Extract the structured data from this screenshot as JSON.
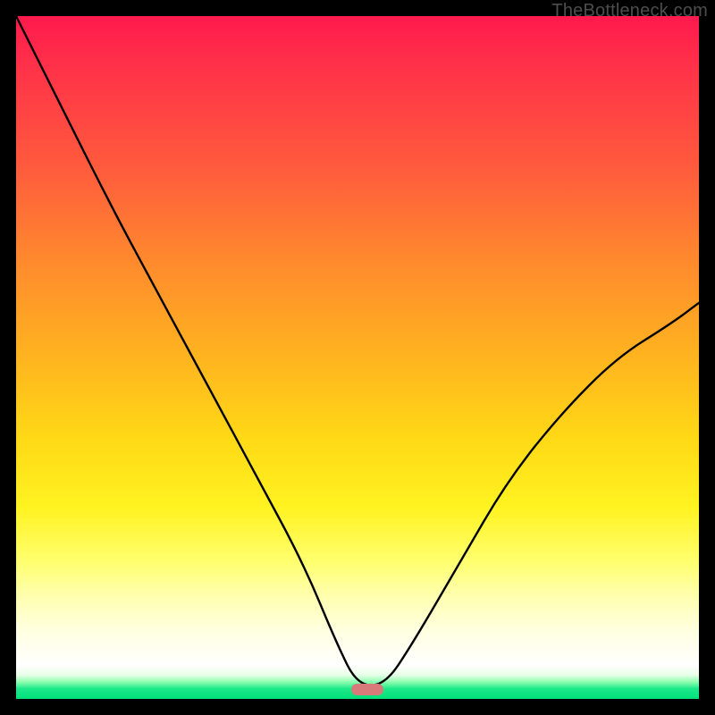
{
  "watermark": "TheBottleneck.com",
  "marker": {
    "x_frac": 0.515,
    "y_frac": 0.986
  },
  "chart_data": {
    "type": "line",
    "title": "",
    "xlabel": "",
    "ylabel": "",
    "xlim": [
      0,
      1
    ],
    "ylim": [
      0,
      1
    ],
    "series": [
      {
        "name": "bottleneck-curve",
        "x": [
          0.0,
          0.07,
          0.14,
          0.21,
          0.28,
          0.35,
          0.42,
          0.47,
          0.5,
          0.54,
          0.58,
          0.65,
          0.72,
          0.8,
          0.88,
          0.96,
          1.0
        ],
        "y": [
          1.0,
          0.86,
          0.72,
          0.59,
          0.46,
          0.33,
          0.2,
          0.08,
          0.02,
          0.02,
          0.08,
          0.2,
          0.32,
          0.42,
          0.5,
          0.55,
          0.58
        ]
      }
    ],
    "annotations": [
      {
        "type": "marker",
        "shape": "rounded-bar",
        "x": 0.515,
        "y": 0.014,
        "color": "#d97a7a"
      }
    ],
    "background_gradient": {
      "type": "vertical",
      "stops": [
        {
          "pos": 0.0,
          "color": "#ff1a4d"
        },
        {
          "pos": 0.5,
          "color": "#ffb41f"
        },
        {
          "pos": 0.8,
          "color": "#ffff70"
        },
        {
          "pos": 0.95,
          "color": "#ffffff"
        },
        {
          "pos": 1.0,
          "color": "#00e07a"
        }
      ]
    }
  }
}
